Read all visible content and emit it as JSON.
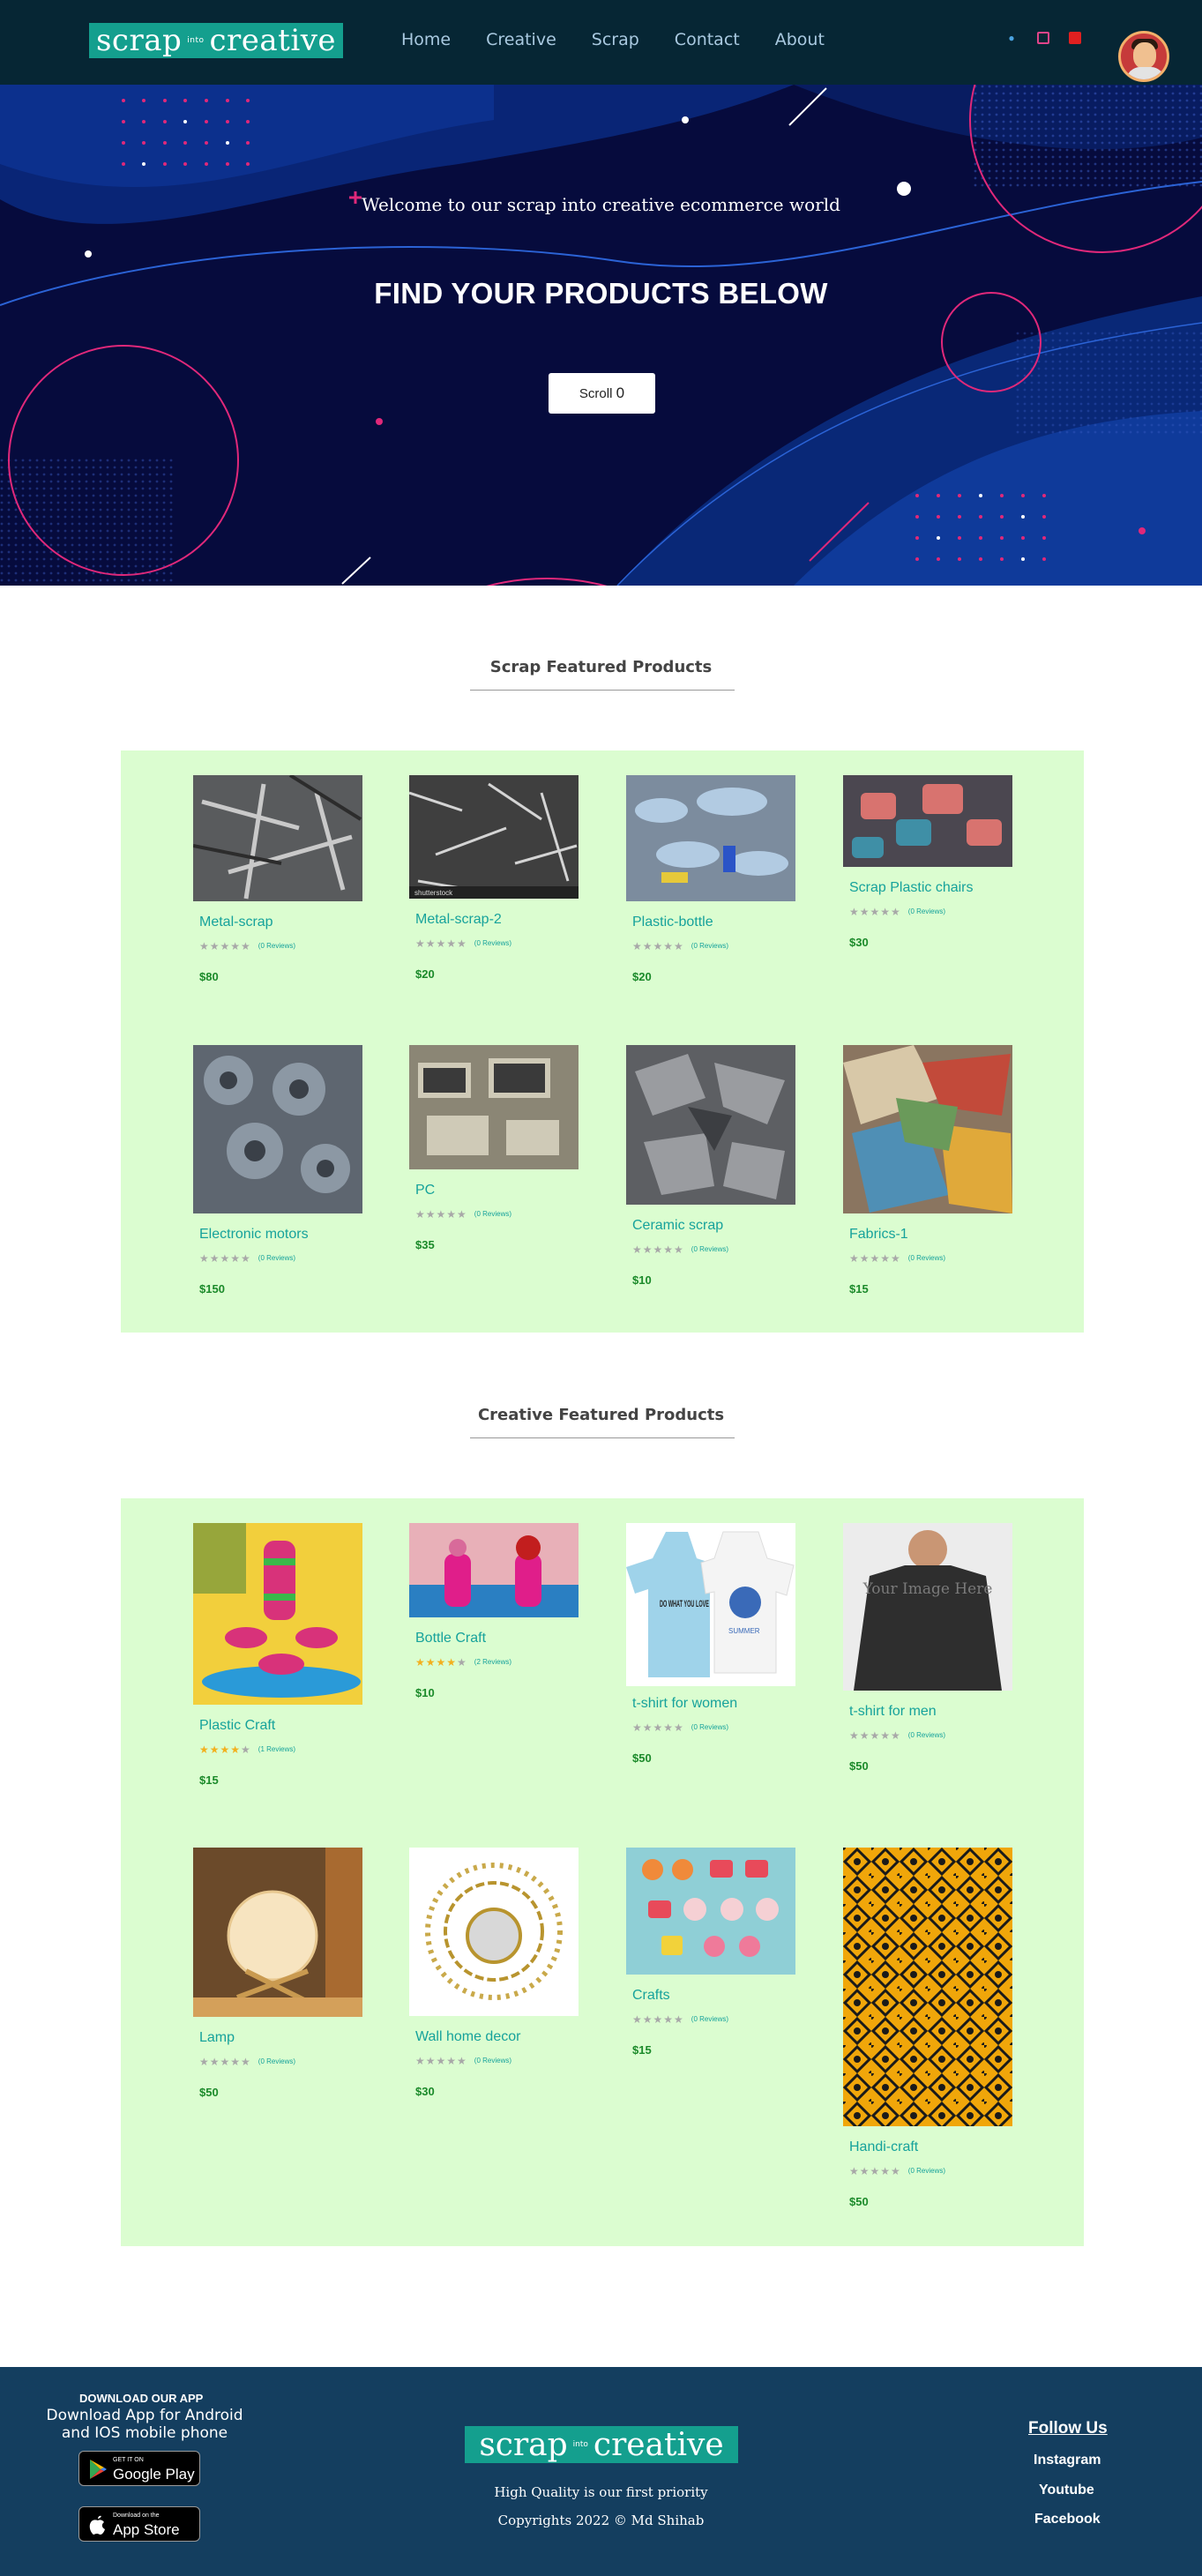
{
  "header": {
    "logo": {
      "left": "scrap",
      "middle": "into",
      "right": "creative"
    },
    "nav": [
      "Home",
      "Creative",
      "Scrap",
      "Contact",
      "About"
    ],
    "icons": [
      "search-icon",
      "cart-icon",
      "user-icon"
    ],
    "accent_color": "#149f8e"
  },
  "hero": {
    "welcome": "Welcome to our scrap into creative ecommerce world",
    "title": "FIND YOUR PRODUCTS BELOW",
    "scroll_label": "Scroll",
    "scroll_glyph": "0"
  },
  "scrap_section": {
    "title": "Scrap Featured Products",
    "products": [
      {
        "name": "Metal-scrap",
        "rating": 0,
        "reviews": "(0 Reviews)",
        "price": "$80"
      },
      {
        "name": "Metal-scrap-2",
        "rating": 0,
        "reviews": "(0 Reviews)",
        "price": "$20"
      },
      {
        "name": "Plastic-bottle",
        "rating": 0,
        "reviews": "(0 Reviews)",
        "price": "$20"
      },
      {
        "name": "Scrap Plastic chairs",
        "rating": 0,
        "reviews": "(0 Reviews)",
        "price": "$30"
      },
      {
        "name": "Electronic motors",
        "rating": 0,
        "reviews": "(0 Reviews)",
        "price": "$150"
      },
      {
        "name": "PC",
        "rating": 0,
        "reviews": "(0 Reviews)",
        "price": "$35"
      },
      {
        "name": "Ceramic scrap",
        "rating": 0,
        "reviews": "(0 Reviews)",
        "price": "$10"
      },
      {
        "name": "Fabrics-1",
        "rating": 0,
        "reviews": "(0 Reviews)",
        "price": "$15"
      }
    ]
  },
  "creative_section": {
    "title": "Creative Featured Products",
    "products": [
      {
        "name": "Plastic Craft",
        "rating": 4,
        "reviews": "(1 Reviews)",
        "price": "$15"
      },
      {
        "name": "Bottle Craft",
        "rating": 4,
        "reviews": "(2 Reviews)",
        "price": "$10"
      },
      {
        "name": "t-shirt for women",
        "rating": 0,
        "reviews": "(0 Reviews)",
        "price": "$50"
      },
      {
        "name": "t-shirt for men",
        "rating": 0,
        "reviews": "(0 Reviews)",
        "price": "$50"
      },
      {
        "name": "Lamp",
        "rating": 0,
        "reviews": "(0 Reviews)",
        "price": "$50"
      },
      {
        "name": "Wall home decor",
        "rating": 0,
        "reviews": "(0 Reviews)",
        "price": "$30"
      },
      {
        "name": "Crafts",
        "rating": 0,
        "reviews": "(0 Reviews)",
        "price": "$15"
      },
      {
        "name": "Handi-craft",
        "rating": 0,
        "reviews": "(0 Reviews)",
        "price": "$50"
      }
    ]
  },
  "image_texts": {
    "shutterstock": "shutterstock",
    "tshirt_men": "Your Image Here",
    "tshirt_women": "DO WHAT YOU LOVE",
    "tshirt_tiger": "SUMMER"
  },
  "footer": {
    "download_title": "DOWNLOAD OUR APP",
    "download_text": "Download App for Android and IOS mobile phone",
    "google_small": "GET IT ON",
    "google_big": "Google Play",
    "apple_small": "Download on the",
    "apple_big": "App Store",
    "quality": "High Quality is our first priority",
    "copyright": "Copyrights 2022 © Md Shihab",
    "follow_title": "Follow Us",
    "social": [
      "Instagram",
      "Youtube",
      "Facebook"
    ]
  }
}
